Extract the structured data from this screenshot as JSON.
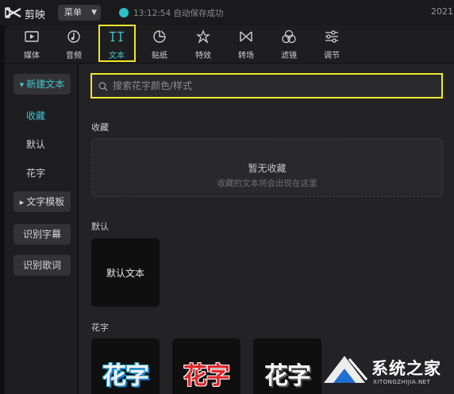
{
  "app": {
    "name": "剪映",
    "menu_label": "菜单",
    "save_status": "13:12:54 自动保存成功",
    "year": "2021"
  },
  "tabs": [
    {
      "label": "媒体",
      "icon": "media-icon",
      "active": false
    },
    {
      "label": "音频",
      "icon": "audio-icon",
      "active": false
    },
    {
      "label": "文本",
      "icon": "text-icon",
      "active": true
    },
    {
      "label": "贴纸",
      "icon": "sticker-icon",
      "active": false
    },
    {
      "label": "特效",
      "icon": "effects-icon",
      "active": false
    },
    {
      "label": "转场",
      "icon": "transition-icon",
      "active": false
    },
    {
      "label": "滤镜",
      "icon": "filter-icon",
      "active": false
    },
    {
      "label": "调节",
      "icon": "adjust-icon",
      "active": false
    }
  ],
  "sidebar": {
    "new_text": "新建文本",
    "items": [
      "收藏",
      "默认",
      "花字"
    ],
    "text_template": "文字模板",
    "recognize_subtitles": "识别字幕",
    "recognize_lyrics": "识别歌词"
  },
  "search": {
    "placeholder": "搜索花字颜色/样式",
    "value": ""
  },
  "sections": {
    "favorites": {
      "title": "收藏",
      "empty_title": "暂无收藏",
      "empty_subtitle": "收藏的文本将会出现在这里"
    },
    "default": {
      "title": "默认",
      "card_label": "默认文本"
    },
    "fancy": {
      "title": "花字",
      "cards": [
        "花字",
        "花字",
        "花字"
      ]
    }
  },
  "watermark": {
    "text": "系统之家",
    "sub": "XITONGZHIJIA.NET"
  },
  "colors": {
    "accent": "#3ec6cc",
    "highlight": "#f0e82a",
    "background": "#111113"
  }
}
